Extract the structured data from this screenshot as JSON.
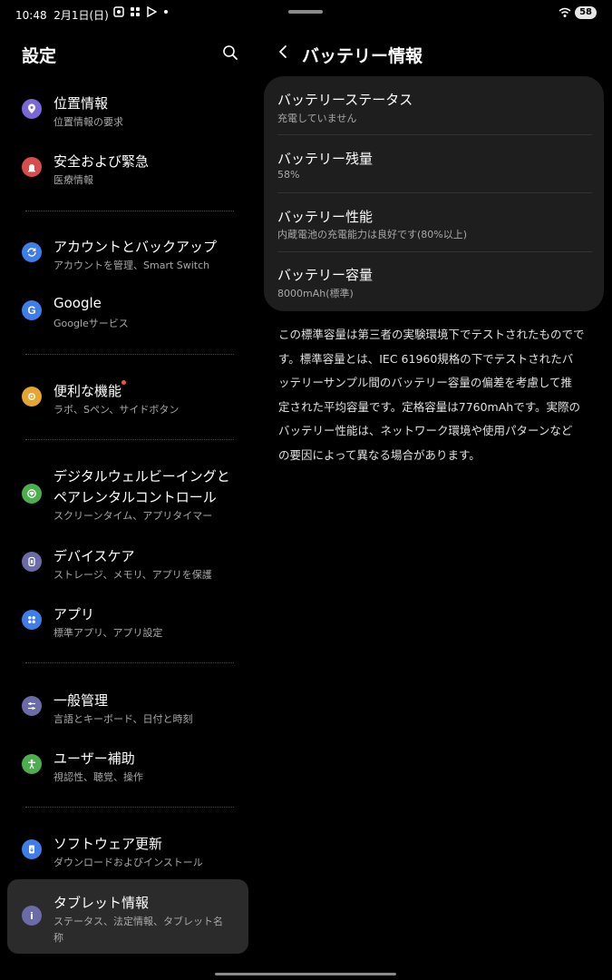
{
  "status_bar": {
    "time": "10:48",
    "date": "2月1日(日)",
    "battery": "58",
    "icons": [
      "screenshot-icon",
      "app-grid-icon",
      "play-store-icon",
      "notification-dot",
      "wifi-icon"
    ]
  },
  "settings": {
    "title": "設定",
    "items": [
      {
        "title": "位置情報",
        "sub": "位置情報の要求",
        "icon": "location-icon",
        "color": "#7b68d8"
      },
      {
        "title": "安全および緊急",
        "sub": "医療情報",
        "icon": "emergency-icon",
        "color": "#d94c4c"
      },
      {
        "title": "アカウントとバックアップ",
        "sub": "アカウントを管理、Smart Switch",
        "icon": "sync-icon",
        "color": "#3f7de8"
      },
      {
        "title": "Google",
        "sub": "Googleサービス",
        "icon": "google-icon",
        "color": "#3f7de8"
      },
      {
        "title": "便利な機能",
        "sub": "ラボ、Sペン、サイドボタン",
        "icon": "advanced-features-icon",
        "color": "#e6a530"
      },
      {
        "title": "デジタルウェルビーイングと",
        "title2": "ペアレンタルコントロール",
        "sub": "スクリーンタイム、アプリタイマー",
        "icon": "wellbeing-icon",
        "color": "#4cae4f"
      },
      {
        "title": "デバイスケア",
        "sub": "ストレージ、メモリ、アプリを保護",
        "icon": "device-care-icon",
        "color": "#6b6ba8"
      },
      {
        "title": "アプリ",
        "sub": "標準アプリ、アプリ設定",
        "icon": "apps-icon",
        "color": "#3f7de8"
      },
      {
        "title": "一般管理",
        "sub": "言語とキーボード、日付と時刻",
        "icon": "general-management-icon",
        "color": "#6b6ba8"
      },
      {
        "title": "ユーザー補助",
        "sub": "視認性、聴覚、操作",
        "icon": "accessibility-icon",
        "color": "#4cae4f"
      },
      {
        "title": "ソフトウェア更新",
        "sub": "ダウンロードおよびインストール",
        "icon": "software-update-icon",
        "color": "#3f7de8"
      },
      {
        "title": "タブレット情報",
        "sub": "ステータス、法定情報、タブレット名",
        "sub2": "称",
        "icon": "info-icon",
        "color": "#6b6ba8"
      }
    ]
  },
  "battery_info": {
    "title": "バッテリー情報",
    "rows": [
      {
        "label": "バッテリーステータス",
        "value": "充電していません"
      },
      {
        "label": "バッテリー残量",
        "value": "58%"
      },
      {
        "label": "バッテリー性能",
        "value": "内蔵電池の充電能力は良好です(80%以上)"
      },
      {
        "label": "バッテリー容量",
        "value": "8000mAh(標準)"
      }
    ],
    "note_lines": [
      "この標準容量は第三者の実験環境下でテストされたものでで",
      "す。標準容量とは、IEC 61960規格の下でテストされたバ",
      "ッテリーサンプル間のバッテリー容量の偏差を考慮して推",
      "定された平均容量です。定格容量は7760mAhです。実際の",
      "バッテリー性能は、ネットワーク環境や使用パターンなど",
      "の要因によって異なる場合があります。"
    ]
  }
}
